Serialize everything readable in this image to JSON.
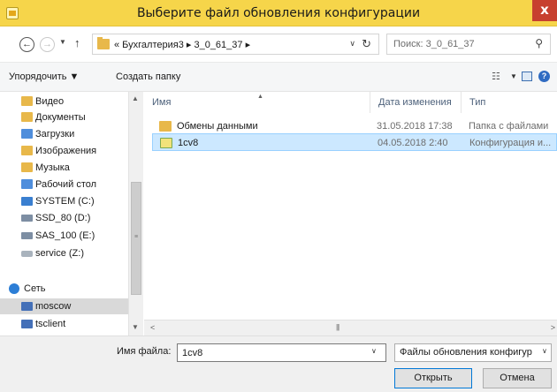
{
  "window": {
    "title": "Выберите файл обновления конфигурации",
    "close_glyph": "x"
  },
  "address": {
    "path": "« Бухгалтерия3 ▸ 3_0_61_37 ▸",
    "search_placeholder": "Поиск: 3_0_61_37"
  },
  "toolbar": {
    "organize": "Упорядочить ▼",
    "new_folder": "Создать папку"
  },
  "nav_pane": {
    "items": [
      {
        "label": "Видео",
        "icon": "video-folder-icon"
      },
      {
        "label": "Документы",
        "icon": "documents-folder-icon"
      },
      {
        "label": "Загрузки",
        "icon": "downloads-folder-icon"
      },
      {
        "label": "Изображения",
        "icon": "pictures-folder-icon"
      },
      {
        "label": "Музыка",
        "icon": "music-folder-icon"
      },
      {
        "label": "Рабочий стол",
        "icon": "desktop-folder-icon"
      },
      {
        "label": "SYSTEM (C:)",
        "icon": "system-drive-icon"
      },
      {
        "label": "SSD_80 (D:)",
        "icon": "drive-icon"
      },
      {
        "label": "SAS_100 (E:)",
        "icon": "drive-icon"
      },
      {
        "label": "service (Z:)",
        "icon": "network-drive-icon"
      },
      {
        "label": "Сеть",
        "icon": "network-icon"
      },
      {
        "label": "moscow",
        "icon": "computer-icon",
        "selected": true
      },
      {
        "label": "tsclient",
        "icon": "computer-icon"
      }
    ]
  },
  "file_list": {
    "columns": {
      "name": "Имя",
      "date": "Дата изменения",
      "type": "Тип"
    },
    "rows": [
      {
        "name": "Обмены данными",
        "date": "31.05.2018 17:38",
        "type": "Папка с файлами",
        "icon": "folder-icon",
        "selected": false
      },
      {
        "name": "1cv8",
        "date": "04.05.2018 2:40",
        "type": "Конфигурация и...",
        "icon": "config-file-icon",
        "selected": true
      }
    ]
  },
  "bottom": {
    "filename_label": "Имя файла:",
    "filename_value": "1cv8",
    "filter_value": "Файлы обновления конфигур",
    "open_label": "Открыть",
    "cancel_label": "Отмена"
  }
}
